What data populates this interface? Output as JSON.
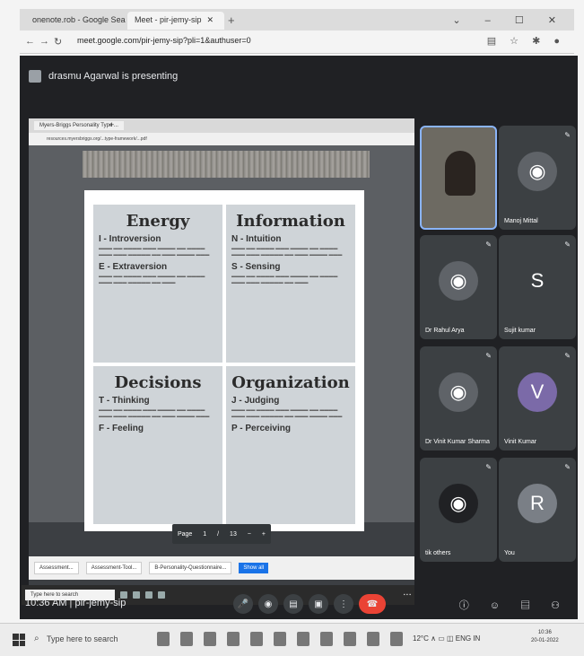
{
  "browser": {
    "tabs": [
      {
        "label": "onenote.rob - Google Search",
        "close": "x"
      },
      {
        "label": "Meet - pir-jemy-sip",
        "close": ""
      }
    ],
    "url": "meet.google.com/pir-jemy-sip?pli=1&authuser=0"
  },
  "meet": {
    "presenting": "drasmu Agarwal is presenting",
    "code": "pir-jemy-sip",
    "time": "10:36 AM"
  },
  "shared_doc": {
    "tab_label": "Myers-Briggs Personality Type ...",
    "url": "resources.myersbriggs.org/...type-framework/...pdf",
    "quadrants": [
      {
        "title": "Energy",
        "h1": "I - Introversion",
        "h2": "E - Extraversion"
      },
      {
        "title": "Information",
        "h1": "N - Intuition",
        "h2": "S - Sensing"
      },
      {
        "title": "Decisions",
        "h1": "T - Thinking",
        "h2": "F - Feeling"
      },
      {
        "title": "Organization",
        "h1": "J - Judging",
        "h2": "P - Perceiving"
      }
    ],
    "page_label": "Page",
    "page_num": "1",
    "page_total": "13",
    "downloads": [
      "Assessment...",
      "Assessment-Tool...",
      "B-Personality-Questionnaire..."
    ],
    "show_all": "Show all",
    "inner_search": "Type here to search"
  },
  "participants": [
    {
      "name": "",
      "initial": "",
      "video": true
    },
    {
      "name": "Manoj Mittal",
      "initial": ""
    },
    {
      "name": "Dr Rahul Arya",
      "initial": ""
    },
    {
      "name": "Sujit kumar",
      "initial": "S"
    },
    {
      "name": "Dr Vinit Kumar Sharma",
      "initial": ""
    },
    {
      "name": "Vinit Kumar",
      "initial": "V"
    },
    {
      "name": "tik others",
      "initial": ""
    },
    {
      "name": "You",
      "initial": "R"
    }
  ],
  "taskbar": {
    "search": "Type here to search",
    "weather": "12°C",
    "lang": "ENG",
    "region": "IN",
    "time": "10:36",
    "date": "20-01-2022"
  }
}
